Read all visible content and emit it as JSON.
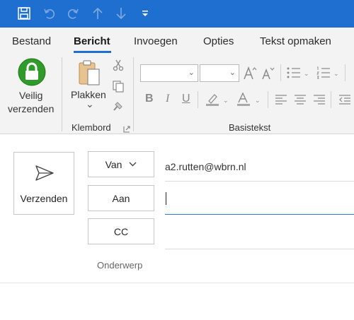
{
  "colors": {
    "titlebar": "#1e6fd0",
    "accent": "#1f6fcf",
    "ribbon": "#f3f3f3"
  },
  "titlebar": {
    "icons": [
      "save-icon",
      "undo-icon",
      "redo-icon",
      "arrow-up-icon",
      "arrow-down-icon",
      "customize-toolbar-icon"
    ]
  },
  "tabs": [
    {
      "label": "Bestand",
      "active": false
    },
    {
      "label": "Bericht",
      "active": true
    },
    {
      "label": "Invoegen",
      "active": false
    },
    {
      "label": "Opties",
      "active": false
    },
    {
      "label": "Tekst opmaken",
      "active": false
    }
  ],
  "ribbon": {
    "secure_send": {
      "line1": "Veilig",
      "line2": "verzenden",
      "icon": "lock-icon"
    },
    "paste": {
      "label": "Plakken",
      "icon": "clipboard-icon",
      "dropdown": "⌄"
    },
    "clipboard_group": "Klembord",
    "basic_text_group": "Basistekst",
    "icons": [
      "cut-icon",
      "copy-icon",
      "format-painter-icon",
      "grow-font-icon",
      "shrink-font-icon",
      "bullets-icon",
      "numbering-icon",
      "bold-icon",
      "italic-icon",
      "underline-icon",
      "highlight-icon",
      "font-color-icon",
      "align-left-icon",
      "align-center-icon",
      "align-right-icon",
      "dialog-launcher-icon"
    ],
    "bold": "B",
    "italic": "I",
    "underline": "U"
  },
  "compose": {
    "send_label": "Verzenden",
    "from_label": "Van",
    "from_value": "a2.rutten@wbrn.nl",
    "to_label": "Aan",
    "cc_label": "CC",
    "subject_label": "Onderwerp"
  }
}
